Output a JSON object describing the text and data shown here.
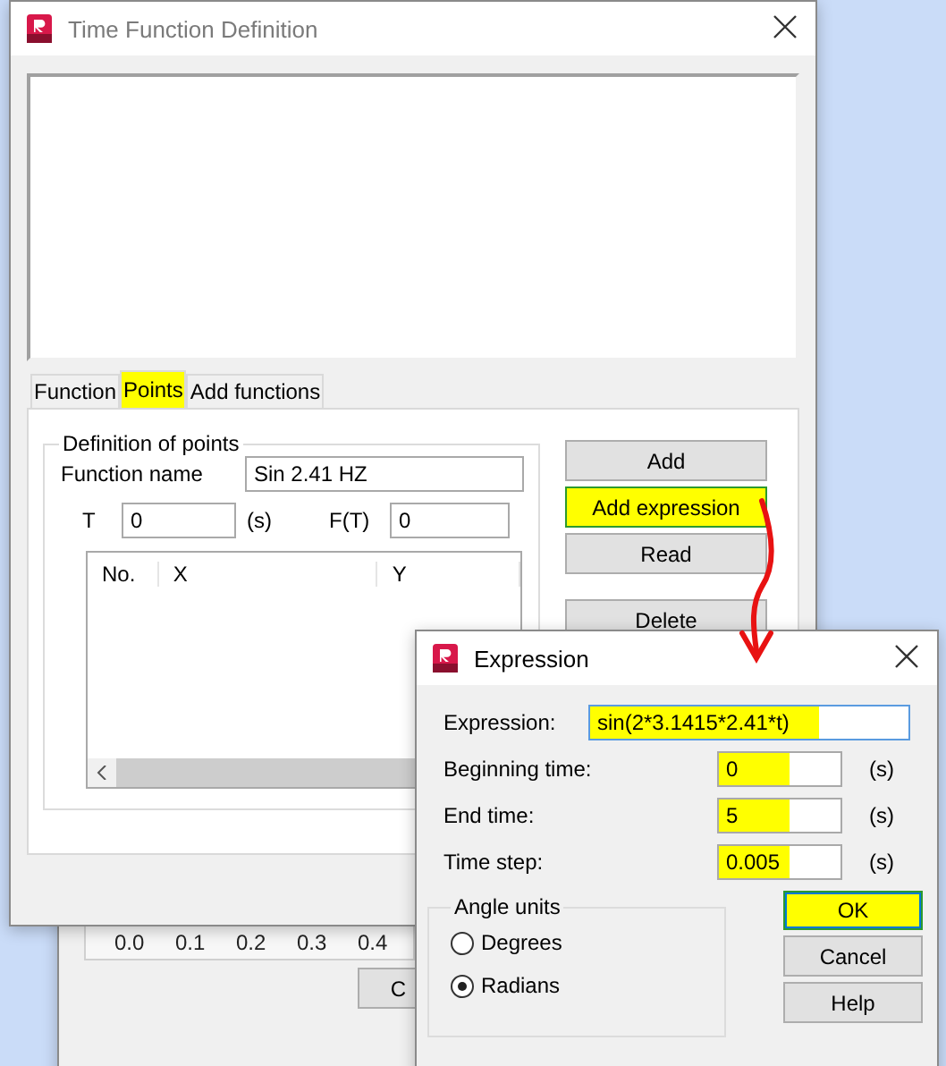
{
  "background_window": {
    "axis_labels": [
      "0.0",
      "0.1",
      "0.2",
      "0.3",
      "0.4"
    ],
    "button": "C"
  },
  "main_dialog": {
    "title": "Time Function Definition",
    "tabs": [
      {
        "label": "Function",
        "selected": false,
        "highlighted": false
      },
      {
        "label": "Points",
        "selected": true,
        "highlighted": true
      },
      {
        "label": "Add functions",
        "selected": false,
        "highlighted": false
      }
    ],
    "group_title": "Definition of points",
    "function_name": {
      "label": "Function name",
      "value": "Sin 2.41 HZ"
    },
    "t": {
      "label": "T",
      "value": "0",
      "unit": "(s)"
    },
    "ft": {
      "label": "F(T)",
      "value": "0"
    },
    "table": {
      "columns": [
        "No.",
        "X",
        "Y"
      ]
    },
    "buttons": [
      {
        "label": "Add",
        "highlighted": false
      },
      {
        "label": "Add expression",
        "highlighted": true
      },
      {
        "label": "Read",
        "highlighted": false
      },
      {
        "label": "Delete",
        "highlighted": false
      }
    ]
  },
  "expression_dialog": {
    "title": "Expression",
    "fields": [
      {
        "kind": "wide",
        "label": "Expression:",
        "value": "sin(2*3.1415*2.41*t)",
        "highlighted": true
      },
      {
        "kind": "timed",
        "label": "Beginning time:",
        "value": "0",
        "unit": "(s)",
        "highlighted": true
      },
      {
        "kind": "timed",
        "label": "End time:",
        "value": "5",
        "unit": "(s)",
        "highlighted": true
      },
      {
        "kind": "timed",
        "label": "Time step:",
        "value": "0.005",
        "unit": "(s)",
        "highlighted": true
      }
    ],
    "angle_units": {
      "title": "Angle units",
      "options": [
        {
          "label": "Degrees",
          "selected": false
        },
        {
          "label": "Radians",
          "selected": true
        }
      ]
    },
    "buttons": [
      {
        "label": "OK",
        "highlighted": true,
        "default": true
      },
      {
        "label": "Cancel",
        "highlighted": false,
        "default": false
      },
      {
        "label": "Help",
        "highlighted": false,
        "default": false
      }
    ]
  }
}
